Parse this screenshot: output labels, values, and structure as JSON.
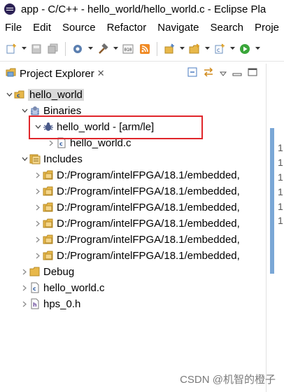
{
  "window": {
    "title": "app - C/C++ - hello_world/hello_world.c - Eclipse Pla"
  },
  "menu": [
    "File",
    "Edit",
    "Source",
    "Refactor",
    "Navigate",
    "Search",
    "Proje"
  ],
  "view": {
    "tab_label": "Project Explorer",
    "close_glyph": "✕"
  },
  "tree": {
    "project": "hello_world",
    "binaries": "Binaries",
    "binary_item": "hello_world - [arm/le]",
    "binary_child": "hello_world.c",
    "includes": "Includes",
    "include_paths": [
      "D:/Program/intelFPGA/18.1/embedded,",
      "D:/Program/intelFPGA/18.1/embedded,",
      "D:/Program/intelFPGA/18.1/embedded,",
      "D:/Program/intelFPGA/18.1/embedded,",
      "D:/Program/intelFPGA/18.1/embedded,",
      "D:/Program/intelFPGA/18.1/embedded,"
    ],
    "debug": "Debug",
    "source_file": "hello_world.c",
    "header_file": "hps_0.h"
  },
  "gutter_numbers": [
    "1",
    "1",
    "1",
    "1",
    "1",
    "1"
  ],
  "watermark": "CSDN @机智的橙子",
  "colors": {
    "highlight": "#e0262b",
    "selection": "#d9d9d9",
    "folder": "#e8b84a"
  }
}
